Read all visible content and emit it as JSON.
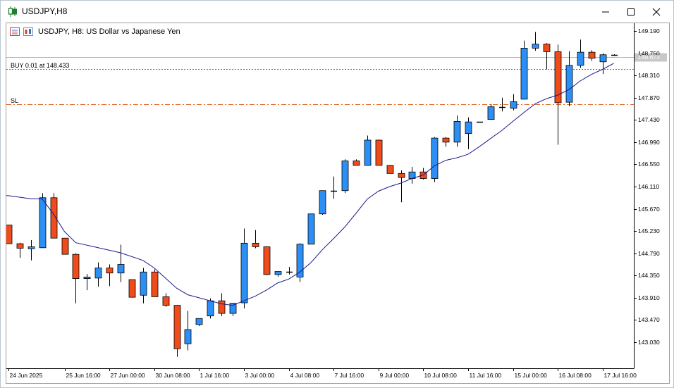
{
  "window": {
    "title": "USDJPY,H8",
    "buttons": [
      "minimize",
      "maximize",
      "close"
    ]
  },
  "chart_header": {
    "text": "USDJPY, H8:  US Dollar vs Japanese Yen"
  },
  "lines": {
    "buy_label": "BUY 0.01 at 148.433",
    "buy_price": 148.433,
    "sl_label": "SL",
    "sl_price": 147.743,
    "bid_price": 148.673,
    "bid_label": "148.673"
  },
  "colors": {
    "bull": "#2c8ff5",
    "bear": "#f04b1a",
    "ma": "#1a1a8c",
    "buy_line": "#3a8c3a",
    "sl_line": "#e46422",
    "bid_line": "#b4b4b4"
  },
  "chart_data": {
    "type": "candlestick",
    "symbol": "USDJPY",
    "timeframe": "H8",
    "ylim": [
      142.65,
      149.39
    ],
    "y_ticks": [
      "149.190",
      "148.750",
      "148.310",
      "147.870",
      "147.430",
      "146.990",
      "146.550",
      "146.110",
      "145.670",
      "145.230",
      "144.790",
      "144.350",
      "143.910",
      "143.470",
      "143.030"
    ],
    "x_ticks": [
      {
        "label": "24 Jun 2025",
        "index": 0
      },
      {
        "label": "25 Jun 16:00",
        "index": 5
      },
      {
        "label": "27 Jun 00:00",
        "index": 9
      },
      {
        "label": "30 Jun 08:00",
        "index": 13
      },
      {
        "label": "1 Jul 16:00",
        "index": 17
      },
      {
        "label": "3 Jul 00:00",
        "index": 21
      },
      {
        "label": "4 Jul 08:00",
        "index": 25
      },
      {
        "label": "7 Jul 16:00",
        "index": 29
      },
      {
        "label": "9 Jul 00:00",
        "index": 33
      },
      {
        "label": "10 Jul 08:00",
        "index": 37
      },
      {
        "label": "11 Jul 16:00",
        "index": 41
      },
      {
        "label": "15 Jul 00:00",
        "index": 45
      },
      {
        "label": "16 Jul 08:00",
        "index": 49
      },
      {
        "label": "17 Jul 16:00",
        "index": 53
      }
    ],
    "candles": [
      {
        "o": 145.35,
        "h": 145.35,
        "l": 144.98,
        "c": 144.98
      },
      {
        "o": 144.98,
        "h": 145.0,
        "l": 144.7,
        "c": 144.89
      },
      {
        "o": 144.88,
        "h": 145.05,
        "l": 144.65,
        "c": 144.92
      },
      {
        "o": 144.9,
        "h": 145.98,
        "l": 144.9,
        "c": 145.89
      },
      {
        "o": 145.89,
        "h": 145.98,
        "l": 145.09,
        "c": 145.09
      },
      {
        "o": 145.09,
        "h": 145.09,
        "l": 144.77,
        "c": 144.77
      },
      {
        "o": 144.77,
        "h": 144.79,
        "l": 143.8,
        "c": 144.29
      },
      {
        "o": 144.29,
        "h": 144.38,
        "l": 144.06,
        "c": 144.32
      },
      {
        "o": 144.3,
        "h": 144.61,
        "l": 144.13,
        "c": 144.5
      },
      {
        "o": 144.5,
        "h": 144.57,
        "l": 144.14,
        "c": 144.4
      },
      {
        "o": 144.4,
        "h": 144.96,
        "l": 144.22,
        "c": 144.57
      },
      {
        "o": 144.27,
        "h": 144.27,
        "l": 143.92,
        "c": 143.92
      },
      {
        "o": 143.96,
        "h": 144.5,
        "l": 143.8,
        "c": 144.42
      },
      {
        "o": 144.42,
        "h": 144.47,
        "l": 143.93,
        "c": 143.93
      },
      {
        "o": 143.93,
        "h": 144.0,
        "l": 143.73,
        "c": 143.76
      },
      {
        "o": 143.76,
        "h": 143.76,
        "l": 142.74,
        "c": 142.9
      },
      {
        "o": 143.0,
        "h": 143.65,
        "l": 142.87,
        "c": 143.28
      },
      {
        "o": 143.38,
        "h": 143.5,
        "l": 143.35,
        "c": 143.5
      },
      {
        "o": 143.55,
        "h": 143.9,
        "l": 143.5,
        "c": 143.85
      },
      {
        "o": 143.85,
        "h": 144.0,
        "l": 143.55,
        "c": 143.6
      },
      {
        "o": 143.6,
        "h": 143.81,
        "l": 143.55,
        "c": 143.8
      },
      {
        "o": 143.81,
        "h": 145.28,
        "l": 143.7,
        "c": 144.99
      },
      {
        "o": 144.99,
        "h": 145.25,
        "l": 144.89,
        "c": 144.92
      },
      {
        "o": 144.92,
        "h": 144.93,
        "l": 144.36,
        "c": 144.37
      },
      {
        "o": 144.37,
        "h": 144.43,
        "l": 144.33,
        "c": 144.43
      },
      {
        "o": 144.43,
        "h": 144.52,
        "l": 144.37,
        "c": 144.43
      },
      {
        "o": 144.32,
        "h": 144.99,
        "l": 144.22,
        "c": 144.97
      },
      {
        "o": 144.97,
        "h": 145.57,
        "l": 144.97,
        "c": 145.57
      },
      {
        "o": 145.57,
        "h": 146.03,
        "l": 145.55,
        "c": 146.03
      },
      {
        "o": 146.03,
        "h": 146.31,
        "l": 145.87,
        "c": 146.03
      },
      {
        "o": 146.03,
        "h": 146.65,
        "l": 145.98,
        "c": 146.62
      },
      {
        "o": 146.62,
        "h": 146.65,
        "l": 146.53,
        "c": 146.53
      },
      {
        "o": 146.53,
        "h": 147.12,
        "l": 146.53,
        "c": 147.03
      },
      {
        "o": 147.03,
        "h": 147.04,
        "l": 146.53,
        "c": 146.53
      },
      {
        "o": 146.53,
        "h": 146.54,
        "l": 146.38,
        "c": 146.37
      },
      {
        "o": 146.37,
        "h": 146.43,
        "l": 145.8,
        "c": 146.29
      },
      {
        "o": 146.27,
        "h": 146.5,
        "l": 146.17,
        "c": 146.4
      },
      {
        "o": 146.4,
        "h": 146.48,
        "l": 146.25,
        "c": 146.27
      },
      {
        "o": 146.27,
        "h": 147.09,
        "l": 146.2,
        "c": 147.07
      },
      {
        "o": 147.07,
        "h": 147.09,
        "l": 146.9,
        "c": 146.99
      },
      {
        "o": 146.99,
        "h": 147.52,
        "l": 146.9,
        "c": 147.4
      },
      {
        "o": 147.16,
        "h": 147.48,
        "l": 146.85,
        "c": 147.39
      },
      {
        "o": 147.39,
        "h": 147.39,
        "l": 147.39,
        "c": 147.39
      },
      {
        "o": 147.44,
        "h": 147.74,
        "l": 147.44,
        "c": 147.69
      },
      {
        "o": 147.69,
        "h": 147.87,
        "l": 147.6,
        "c": 147.68
      },
      {
        "o": 147.66,
        "h": 147.94,
        "l": 147.62,
        "c": 147.79
      },
      {
        "o": 147.84,
        "h": 149.0,
        "l": 147.84,
        "c": 148.85
      },
      {
        "o": 148.85,
        "h": 149.17,
        "l": 148.8,
        "c": 148.93
      },
      {
        "o": 148.93,
        "h": 148.95,
        "l": 148.43,
        "c": 148.78
      },
      {
        "o": 148.78,
        "h": 148.92,
        "l": 146.94,
        "c": 147.77
      },
      {
        "o": 147.78,
        "h": 148.79,
        "l": 147.7,
        "c": 148.51
      },
      {
        "o": 148.51,
        "h": 149.02,
        "l": 148.46,
        "c": 148.77
      },
      {
        "o": 148.77,
        "h": 148.81,
        "l": 148.6,
        "c": 148.65
      },
      {
        "o": 148.58,
        "h": 148.75,
        "l": 148.34,
        "c": 148.72
      },
      {
        "o": 148.72,
        "h": 148.73,
        "l": 148.7,
        "c": 148.71
      }
    ],
    "ma_series": [
      {
        "index": 0,
        "value": 145.93
      },
      {
        "index": 2,
        "value": 145.87
      },
      {
        "index": 3,
        "value": 145.87
      },
      {
        "index": 4,
        "value": 145.57
      },
      {
        "index": 5,
        "value": 145.22
      },
      {
        "index": 6,
        "value": 145.0
      },
      {
        "index": 8,
        "value": 144.9
      },
      {
        "index": 10,
        "value": 144.8
      },
      {
        "index": 12,
        "value": 144.65
      },
      {
        "index": 13,
        "value": 144.5
      },
      {
        "index": 14,
        "value": 144.3
      },
      {
        "index": 15,
        "value": 144.1
      },
      {
        "index": 16,
        "value": 143.97
      },
      {
        "index": 17,
        "value": 143.91
      },
      {
        "index": 18,
        "value": 143.85
      },
      {
        "index": 19,
        "value": 143.79
      },
      {
        "index": 20,
        "value": 143.76
      },
      {
        "index": 21,
        "value": 143.85
      },
      {
        "index": 22,
        "value": 143.94
      },
      {
        "index": 23,
        "value": 144.06
      },
      {
        "index": 24,
        "value": 144.2
      },
      {
        "index": 25,
        "value": 144.28
      },
      {
        "index": 26,
        "value": 144.42
      },
      {
        "index": 27,
        "value": 144.61
      },
      {
        "index": 28,
        "value": 144.86
      },
      {
        "index": 29,
        "value": 145.08
      },
      {
        "index": 30,
        "value": 145.31
      },
      {
        "index": 31,
        "value": 145.58
      },
      {
        "index": 32,
        "value": 145.86
      },
      {
        "index": 33,
        "value": 146.02
      },
      {
        "index": 34,
        "value": 146.11
      },
      {
        "index": 35,
        "value": 146.18
      },
      {
        "index": 36,
        "value": 146.27
      },
      {
        "index": 37,
        "value": 146.34
      },
      {
        "index": 38,
        "value": 146.52
      },
      {
        "index": 39,
        "value": 146.63
      },
      {
        "index": 40,
        "value": 146.68
      },
      {
        "index": 41,
        "value": 146.75
      },
      {
        "index": 42,
        "value": 146.9
      },
      {
        "index": 43,
        "value": 147.06
      },
      {
        "index": 44,
        "value": 147.22
      },
      {
        "index": 45,
        "value": 147.4
      },
      {
        "index": 46,
        "value": 147.58
      },
      {
        "index": 47,
        "value": 147.75
      },
      {
        "index": 48,
        "value": 147.85
      },
      {
        "index": 49,
        "value": 147.92
      },
      {
        "index": 50,
        "value": 148.03
      },
      {
        "index": 51,
        "value": 148.2
      },
      {
        "index": 52,
        "value": 148.33
      },
      {
        "index": 53,
        "value": 148.43
      },
      {
        "index": 54,
        "value": 148.55
      }
    ]
  }
}
